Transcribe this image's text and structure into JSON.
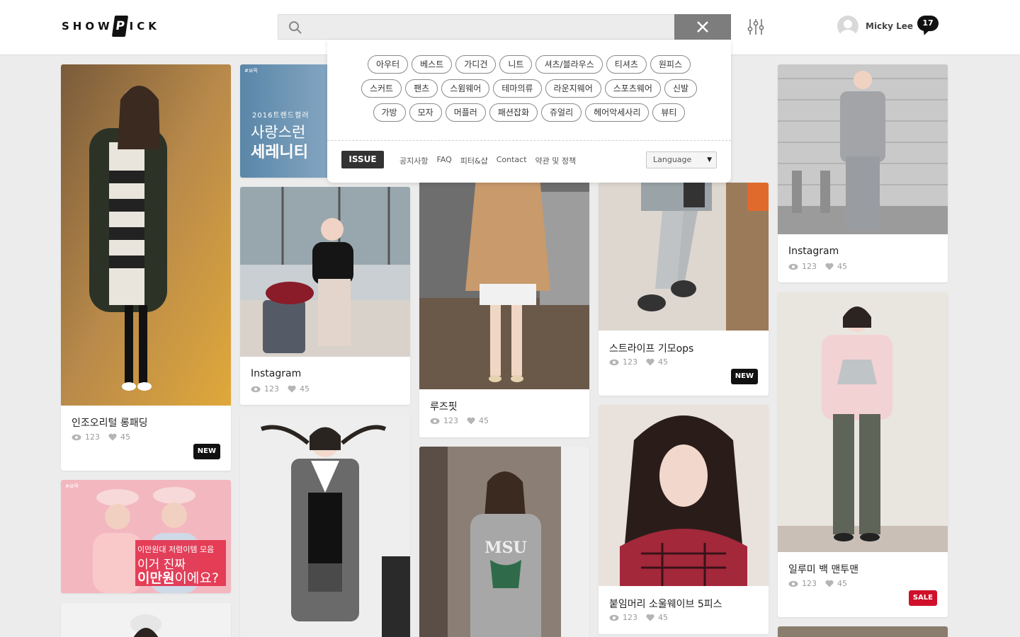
{
  "header": {
    "logo_left": "SHOW",
    "logo_mark": "P",
    "logo_right": "ICK",
    "search_placeholder": "",
    "user_name": "Micky Lee",
    "notification_count": "17"
  },
  "colors": {
    "header_bg": "#ffffff",
    "page_bg": "#ececec",
    "close_button": "#7d7d7d",
    "tag_new": "#111111",
    "tag_sale": "#d0102a"
  },
  "categories": {
    "row1": [
      "아우터",
      "베스트",
      "가디건",
      "니트",
      "셔츠/블라우스",
      "티셔츠",
      "원피스"
    ],
    "row2": [
      "스커트",
      "팬츠",
      "스윔웨어",
      "테마의류",
      "라운지웨어",
      "스포츠웨어",
      "신발"
    ],
    "row3": [
      "가방",
      "모자",
      "머플러",
      "패션잡화",
      "쥬얼리",
      "헤어악세사리",
      "뷰티"
    ]
  },
  "footer_menu": {
    "issue": "ISSUE",
    "links": [
      "공지사항",
      "FAQ",
      "피터&샵",
      "Contact",
      "약관 및 정책"
    ],
    "language": "Language"
  },
  "promos": {
    "promo1": {
      "tag": "#쑈픽",
      "line1": "2016트렌드컬러",
      "line2": "사랑스런",
      "line3": "세레니티"
    },
    "promo2": {
      "tag": "#쑈픽",
      "line1": "이만원대 저렴이템 모음",
      "line2": "이거 진짜",
      "line3_bold": "이만원",
      "line3_rest": "이에요?"
    }
  },
  "cards": [
    {
      "title": "인조오리털 롱패딩",
      "views": "123",
      "likes": "45",
      "tag": "NEW"
    },
    {
      "title": "Instagram",
      "views": "123",
      "likes": "45",
      "tag": ""
    },
    {
      "title": "루즈핏",
      "views": "123",
      "likes": "45",
      "tag": ""
    },
    {
      "title": "스트라이프 기모ops",
      "views": "123",
      "likes": "45",
      "tag": "NEW"
    },
    {
      "title": "Instagram",
      "views": "123",
      "likes": "45",
      "tag": ""
    },
    {
      "title": "붙임머리 소울웨이브 5피스",
      "views": "123",
      "likes": "45",
      "tag": ""
    },
    {
      "title": "일루미 백 맨투맨",
      "views": "123",
      "likes": "45",
      "tag": "SALE"
    }
  ]
}
